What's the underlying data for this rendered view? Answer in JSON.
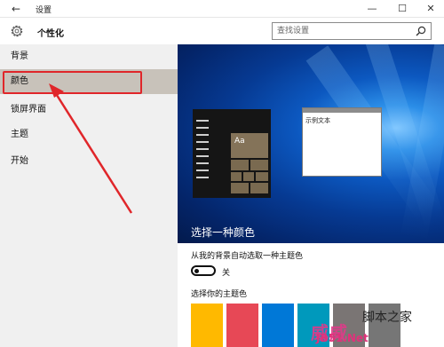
{
  "window": {
    "title": "设置",
    "back_glyph": "←",
    "min_glyph": "—",
    "max_glyph": "☐",
    "close_glyph": "✕"
  },
  "header": {
    "title": "个性化",
    "search_placeholder": "查找设置"
  },
  "sidebar": {
    "items": [
      {
        "label": "背景"
      },
      {
        "label": "颜色"
      },
      {
        "label": "锁屏界面"
      },
      {
        "label": "主题"
      },
      {
        "label": "开始"
      }
    ],
    "selected_index": 1
  },
  "preview": {
    "tile_label": "Aa",
    "window_sample_text": "示例文本",
    "caption": "选择一种颜色"
  },
  "settings": {
    "auto_color_label": "从我的背景自动选取一种主题色",
    "toggle_state": "关",
    "theme_color_label": "选择你的主题色",
    "swatches": [
      "#ffb900",
      "#e74856",
      "#0078d7",
      "#0099bc",
      "#7a7574",
      "#767676"
    ]
  },
  "colors": {
    "accent_selected": "#c8c2ba",
    "annotation_red": "#e0262a",
    "tile_accent": "#847359"
  },
  "watermark": {
    "main": "威威",
    "sub": "脚本之家",
    "url": "JB51.Net"
  }
}
